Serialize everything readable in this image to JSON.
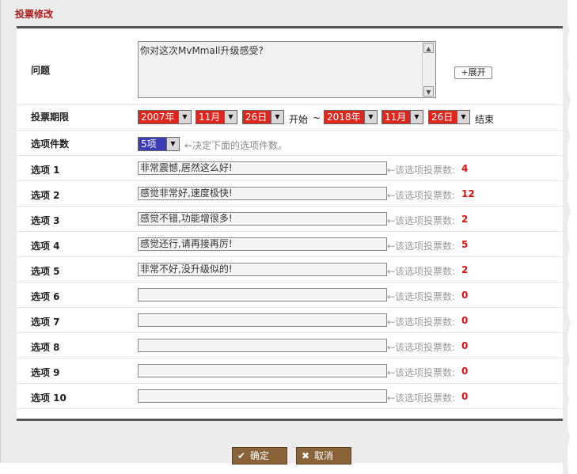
{
  "title": "投票修改",
  "question": {
    "label": "问题",
    "value": "你对这次MvMmall升级感受?",
    "expand": "+展开"
  },
  "period": {
    "label": "投票期限",
    "start_year": "2007年",
    "start_month": "11月",
    "start_day": "26日",
    "start_word": "开始",
    "tilde": "~",
    "end_year": "2018年",
    "end_month": "11月",
    "end_day": "26日",
    "end_word": "结束"
  },
  "option_count": {
    "label": "选项件数",
    "value": "5项",
    "hint": "←决定下面的选项件数。"
  },
  "count_label": "←该选项投票数:",
  "options": [
    {
      "label": "选项 1",
      "value": "非常震憾,居然这么好!",
      "count": "4"
    },
    {
      "label": "选项 2",
      "value": "感觉非常好,速度极快!",
      "count": "12"
    },
    {
      "label": "选项 3",
      "value": "感觉不错,功能增很多!",
      "count": "2"
    },
    {
      "label": "选项 4",
      "value": "感觉还行,请再接再厉!",
      "count": "5"
    },
    {
      "label": "选项 5",
      "value": "非常不好,没升级似的!",
      "count": "2"
    },
    {
      "label": "选项 6",
      "value": "",
      "count": "0"
    },
    {
      "label": "选项 7",
      "value": "",
      "count": "0"
    },
    {
      "label": "选项 8",
      "value": "",
      "count": "0"
    },
    {
      "label": "选项 9",
      "value": "",
      "count": "0"
    },
    {
      "label": "选项 10",
      "value": "",
      "count": "0"
    }
  ],
  "buttons": {
    "confirm": "确定",
    "cancel": "取消"
  },
  "colors": {
    "title": "#b01a1a",
    "select_red": "#e0251d",
    "select_blue": "#3d3db8",
    "count": "#e01010",
    "button": "#8a6338"
  }
}
